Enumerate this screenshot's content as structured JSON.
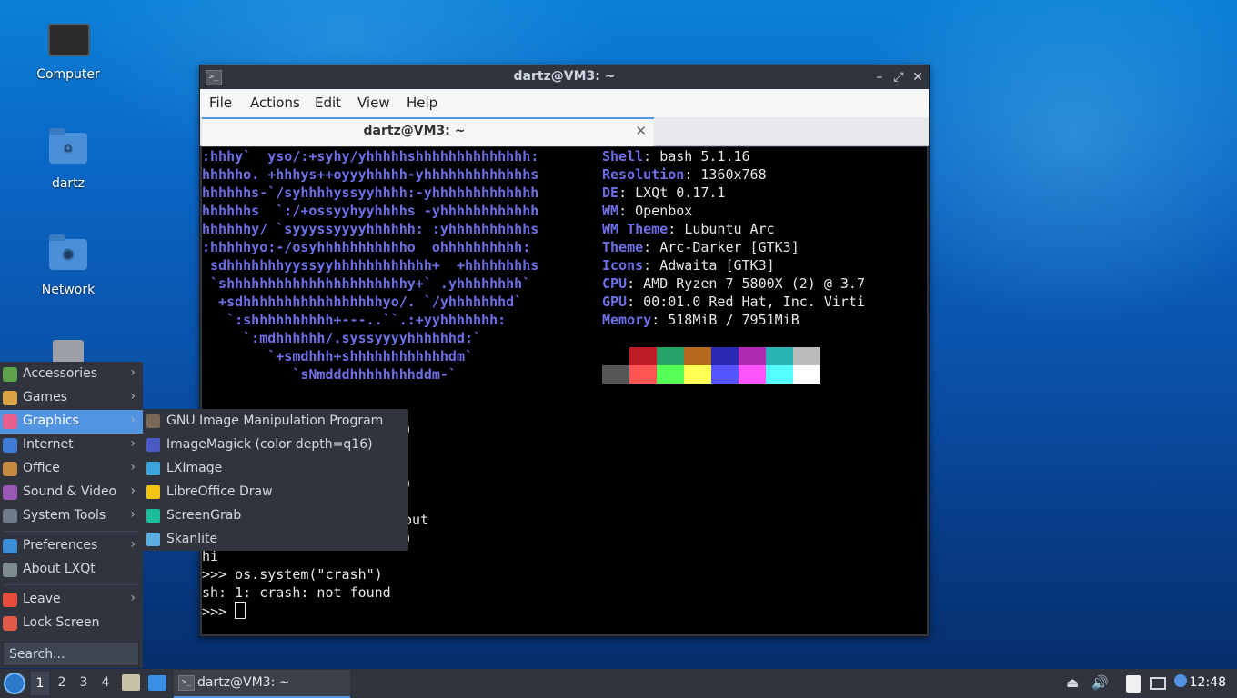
{
  "desktop": {
    "icons": [
      {
        "label": "Computer"
      },
      {
        "label": "dartz"
      },
      {
        "label": "Network"
      }
    ]
  },
  "terminal": {
    "window_title": "dartz@VM3: ~",
    "tab_title": "dartz@VM3: ~",
    "menu": [
      "File",
      "Actions",
      "Edit",
      "View",
      "Help"
    ],
    "ascii_art": [
      ":hhhy`  yso/:+syhy/yhhhhhshhhhhhhhhhhhhh:",
      "hhhhho. +hhhys++oyyyhhhhh-yhhhhhhhhhhhhhs",
      "hhhhhhs-`/syhhhhyssyyhhhh:-yhhhhhhhhhhhhh",
      "hhhhhhs  `:/+ossyyhyyhhhhs -yhhhhhhhhhhhh",
      "hhhhhhy/ `syyyssyyyyhhhhhh: :yhhhhhhhhhhs",
      ":hhhhhyo:-/osyhhhhhhhhhhho  ohhhhhhhhhh:",
      " sdhhhhhhhyyssyyhhhhhhhhhhhh+  +hhhhhhhhs",
      " `shhhhhhhhhhhhhhhhhhhhhhy+` .yhhhhhhhh`",
      "  +sdhhhhhhhhhhhhhhhhhyo/. `/yhhhhhhhd`",
      "   `:shhhhhhhhhh+---..``.:+yyhhhhhhh:",
      "     `:mdhhhhhh/.syssyyyyhhhhhhd:`",
      "        `+smdhhh+shhhhhhhhhhhhdm`",
      "           `sNmdddhhhhhhhhddm-`"
    ],
    "sysinfo": [
      {
        "key": "Shell",
        "value": "bash 5.1.16"
      },
      {
        "key": "Resolution",
        "value": "1360x768"
      },
      {
        "key": "DE",
        "value": "LXQt 0.17.1"
      },
      {
        "key": "WM",
        "value": "Openbox"
      },
      {
        "key": "WM Theme",
        "value": "Lubuntu Arc"
      },
      {
        "key": "Theme",
        "value": "Arc-Darker [GTK3]"
      },
      {
        "key": "Icons",
        "value": "Adwaita [GTK3]"
      },
      {
        "key": "CPU",
        "value": "AMD Ryzen 7 5800X (2) @ 3.7"
      },
      {
        "key": "GPU",
        "value": "00:01.0 Red Hat, Inc. Virti"
      },
      {
        "key": "Memory",
        "value": "518MiB / 7951MiB"
      }
    ],
    "palette_top": [
      "#000000",
      "#c01c28",
      "#26a269",
      "#b5681d",
      "#2a2ab3",
      "#b02ab3",
      "#2ab3b3",
      "#bbbbbb"
    ],
    "palette_bottom": [
      "#555555",
      "#ff5555",
      "#55ff55",
      "#ffff55",
      "#5555ff",
      "#ff55ff",
      "#55ffff",
      "#ffffff"
    ],
    "partial_lines": [
      ")",
      ")",
      "out",
      ")"
    ],
    "output_lines": [
      "hi",
      ">>> os.system(\"crash\")",
      "sh: 1: crash: not found"
    ],
    "prompt": ">>> "
  },
  "start_menu": {
    "items": [
      {
        "label": "Accessories",
        "icon": "accessories-icon",
        "color": "#5fa24c"
      },
      {
        "label": "Games",
        "icon": "games-icon",
        "color": "#d9a441"
      },
      {
        "label": "Graphics",
        "icon": "graphics-icon",
        "color": "#e85c8e"
      },
      {
        "label": "Internet",
        "icon": "internet-icon",
        "color": "#3f7ad6"
      },
      {
        "label": "Office",
        "icon": "office-icon",
        "color": "#c58a3f"
      },
      {
        "label": "Sound & Video",
        "icon": "sound-video-icon",
        "color": "#9b59b6"
      },
      {
        "label": "System Tools",
        "icon": "system-tools-icon",
        "color": "#6c7a89"
      },
      {
        "label": "Preferences",
        "icon": "preferences-icon",
        "color": "#3d8ed8"
      },
      {
        "label": "About LXQt",
        "icon": "about-icon",
        "color": "#7f8c8d"
      },
      {
        "label": "Leave",
        "icon": "leave-icon",
        "color": "#e74c3c"
      },
      {
        "label": "Lock Screen",
        "icon": "lock-icon",
        "color": "#e05a4a"
      }
    ],
    "search_placeholder": "Search..."
  },
  "graphics_submenu": {
    "items": [
      {
        "label": "GNU Image Manipulation Program",
        "icon": "gimp-icon",
        "color": "#7a6a55"
      },
      {
        "label": "ImageMagick (color depth=q16)",
        "icon": "imagemagick-icon",
        "color": "#4b59c4"
      },
      {
        "label": "LXImage",
        "icon": "lximage-icon",
        "color": "#3aa5d9"
      },
      {
        "label": "LibreOffice Draw",
        "icon": "libreoffice-draw-icon",
        "color": "#f1c40f"
      },
      {
        "label": "ScreenGrab",
        "icon": "screengrab-icon",
        "color": "#1abc9c"
      },
      {
        "label": "Skanlite",
        "icon": "skanlite-icon",
        "color": "#5dade2"
      }
    ]
  },
  "taskbar": {
    "workspaces": [
      "1",
      "2",
      "3",
      "4"
    ],
    "task_label": "dartz@VM3: ~",
    "clock": "12:48"
  }
}
